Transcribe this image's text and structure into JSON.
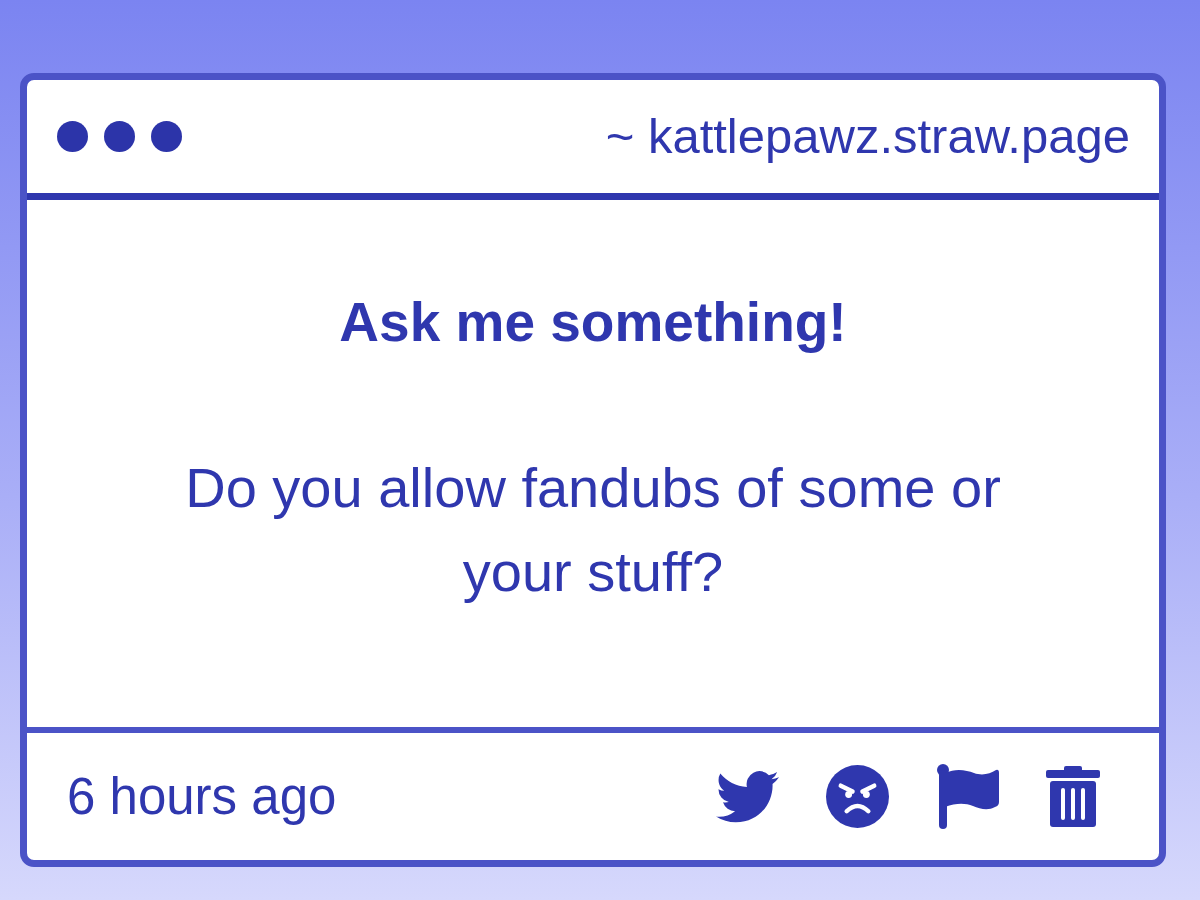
{
  "window": {
    "address": "~ kattlepawz.straw.page"
  },
  "question": {
    "heading": "Ask me something!",
    "text": "Do you allow fandubs of some or your stuff?"
  },
  "footer": {
    "time": "6 hours ago"
  }
}
